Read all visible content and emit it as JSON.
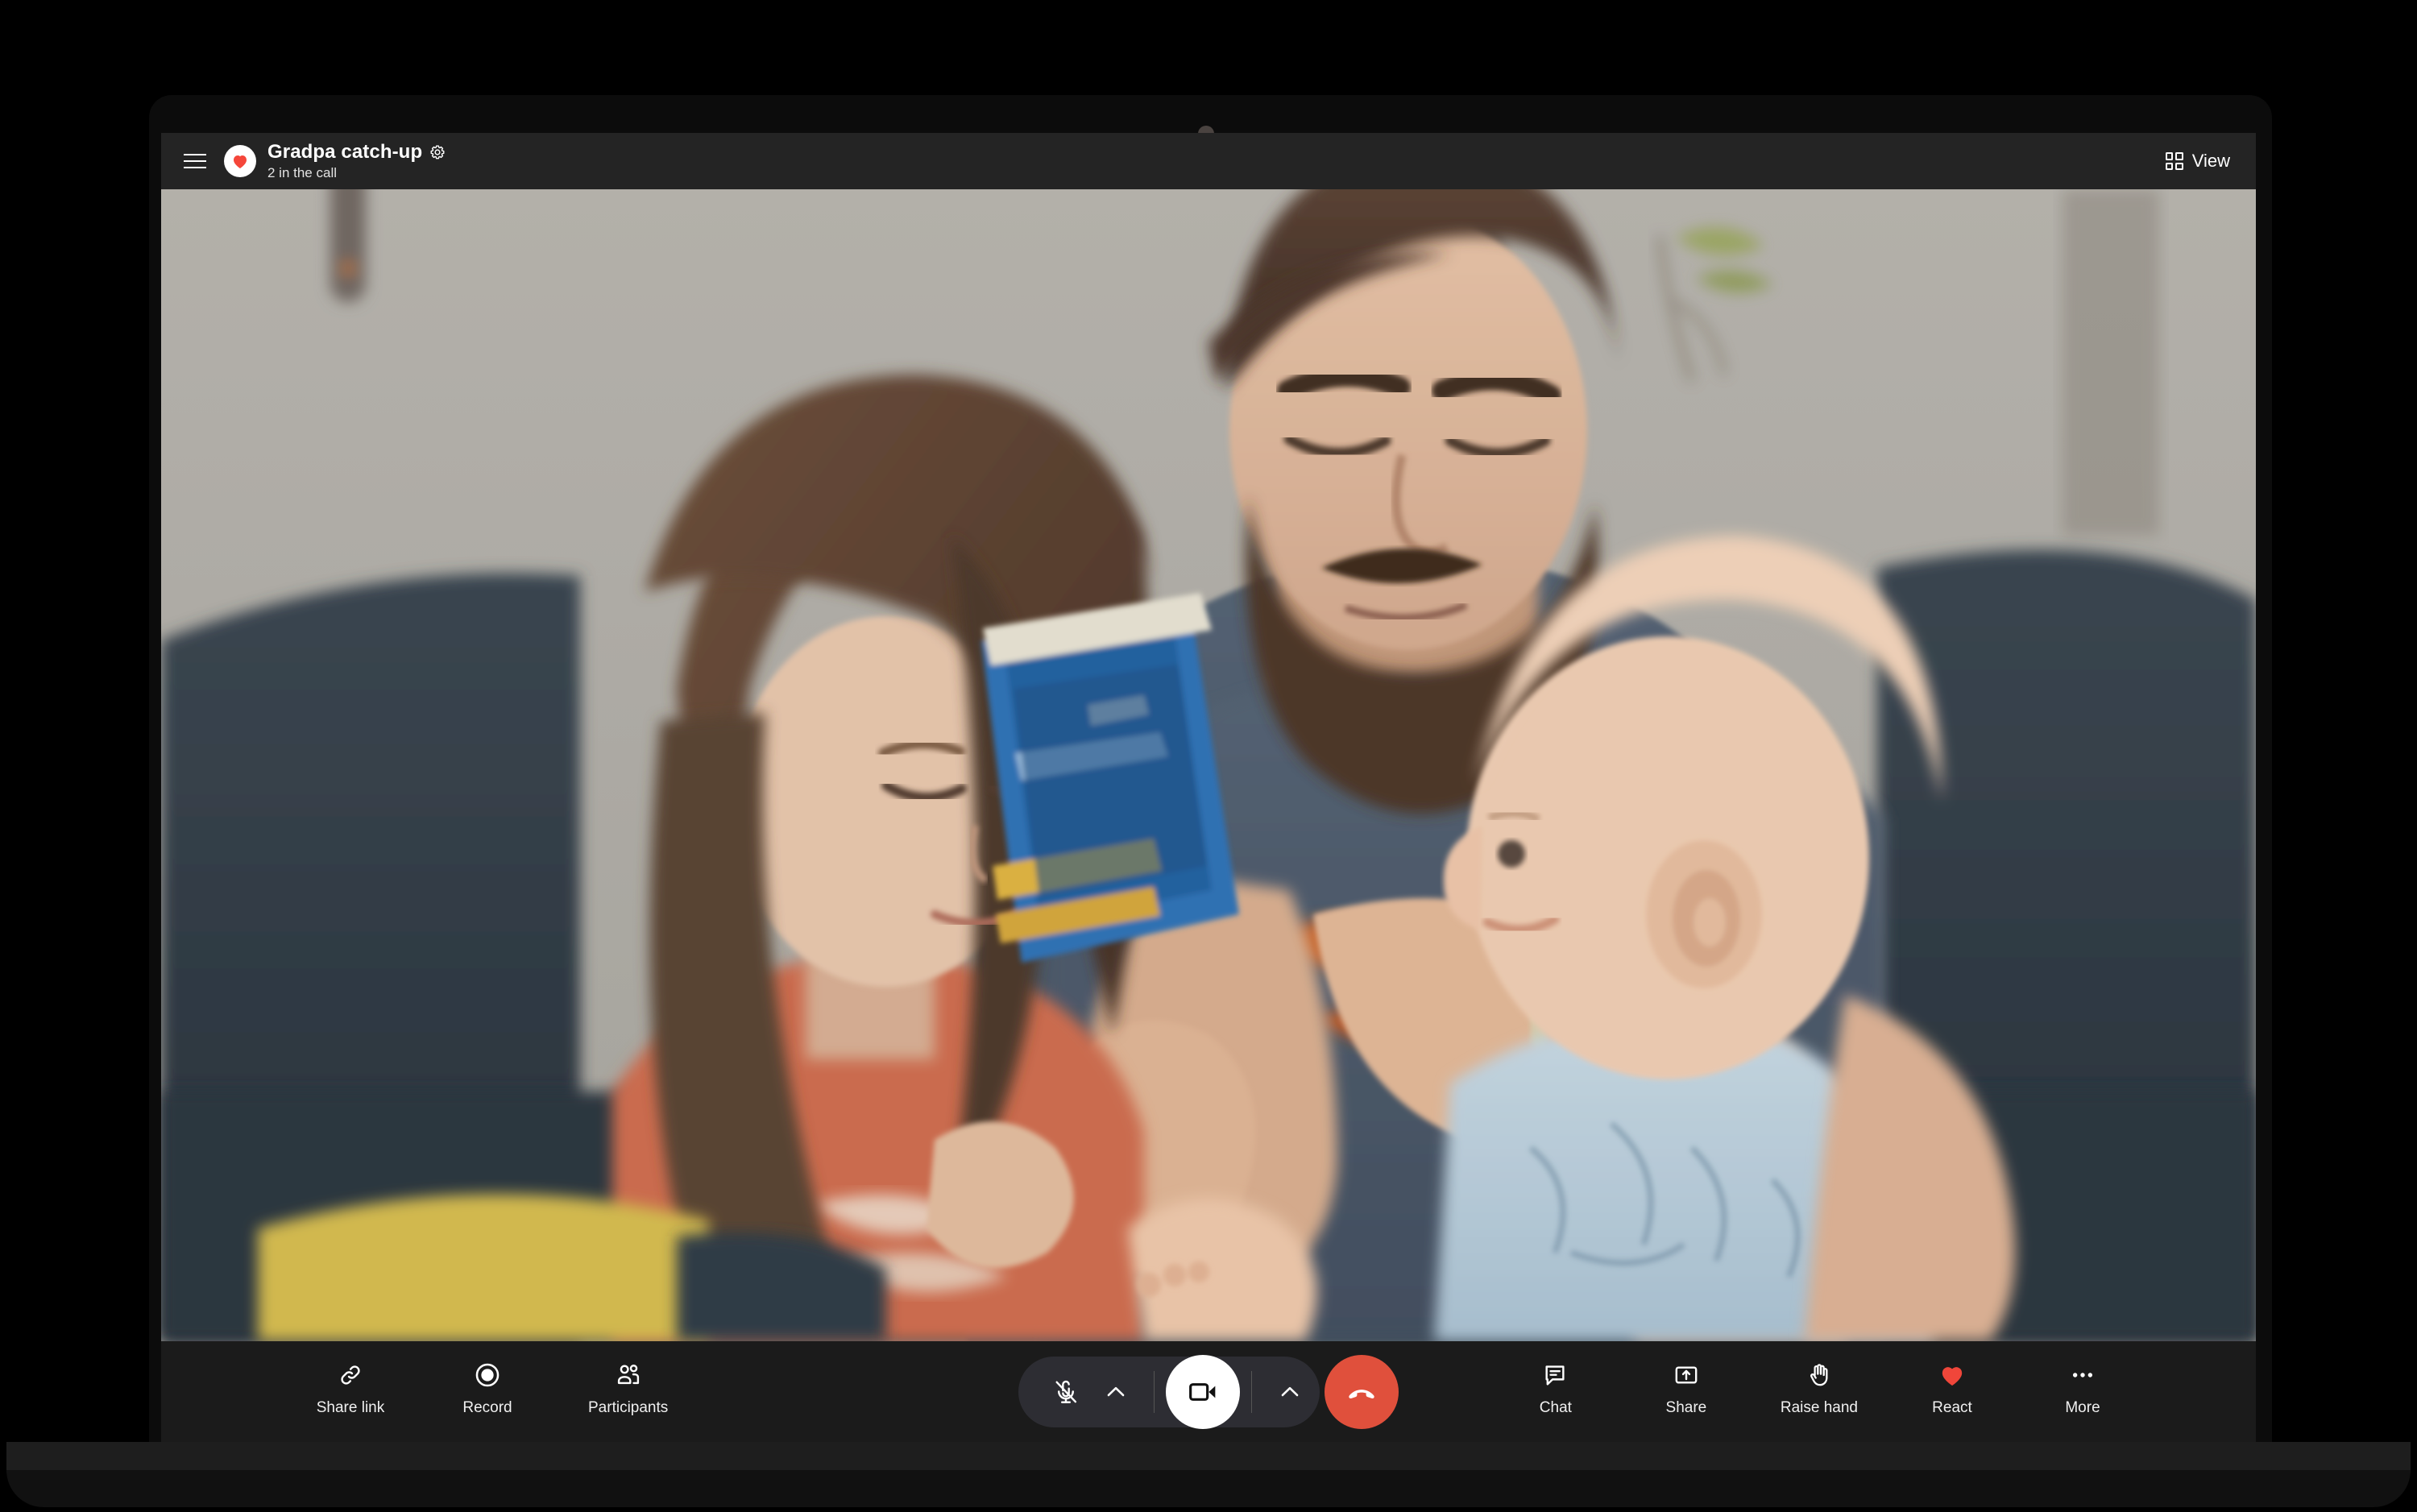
{
  "header": {
    "menu_icon": "hamburger-menu-icon",
    "avatar_icon": "heart-avatar",
    "call_title": "Gradpa catch-up",
    "settings_icon": "gear-icon",
    "participant_count_label": "2 in the call",
    "view_label": "View",
    "view_icon": "grid-view-icon"
  },
  "left_controls": [
    {
      "label": "Share link",
      "icon": "link-icon"
    },
    {
      "label": "Record",
      "icon": "record-icon"
    },
    {
      "label": "Participants",
      "icon": "participants-icon"
    }
  ],
  "center_controls": {
    "mic": {
      "icon": "microphone-muted-icon",
      "state": "muted"
    },
    "mic_options": {
      "icon": "chevron-up-icon"
    },
    "camera": {
      "icon": "camera-icon",
      "state": "on"
    },
    "camera_options": {
      "icon": "chevron-up-icon"
    },
    "hangup": {
      "icon": "end-call-icon"
    }
  },
  "right_controls": [
    {
      "label": "Chat",
      "icon": "chat-bubble-icon"
    },
    {
      "label": "Share",
      "icon": "share-screen-icon"
    },
    {
      "label": "Raise hand",
      "icon": "raise-hand-icon"
    },
    {
      "label": "React",
      "icon": "heart-icon"
    },
    {
      "label": "More",
      "icon": "more-dots-icon"
    }
  ],
  "video": {
    "description": "Video call feed: a bearded man in a blue-grey Detroit t-shirt sits on a dark navy couch reading a blue book to a young girl in an orange t-shirt on his left and a bald baby in a light blue patterned onesie on his right.",
    "wall_color": "#b2afa8",
    "couch_color": "#2f3a43",
    "shirt_color": "#4a5767",
    "shirt_print_color": "#d4601f",
    "girl_shirt_color": "#d2694d",
    "baby_onesie_color": "#b9cfdd",
    "book_color": "#1f63a8",
    "blanket_color": "#d4b94a"
  },
  "colors": {
    "header_bg": "#242424",
    "toolbar_bg": "#1b1b1b",
    "accent_red": "#e0503c",
    "heart_red": "#f0463a",
    "pill_bg": "#2d2d33",
    "text": "#f0f0f0"
  }
}
